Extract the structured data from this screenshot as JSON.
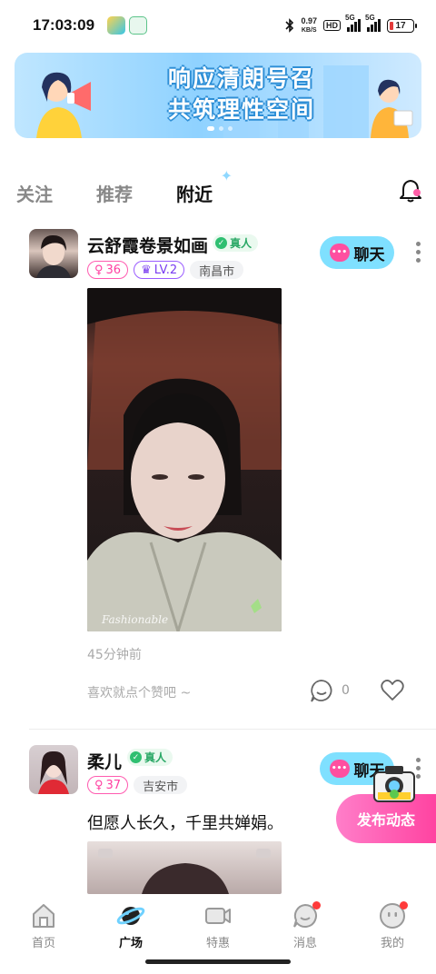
{
  "status_bar": {
    "time": "17:03:09",
    "net_speed_value": "0.97",
    "net_speed_unit": "KB/S",
    "hd_label": "HD",
    "sim1_label": "5G",
    "sim2_label": "5G",
    "battery_level": "17"
  },
  "banner": {
    "line1": "响应清朗号召",
    "line2": "共筑理性空间",
    "accent_color": "#2f8fd6"
  },
  "tabs": [
    {
      "label": "关注"
    },
    {
      "label": "推荐"
    },
    {
      "label": "附近"
    }
  ],
  "active_tab": "附近",
  "posts": [
    {
      "username": "云舒霞卷景如画",
      "verified_label": "真人",
      "likes_tag": "36",
      "level_tag": "LV.2",
      "city": "南昌市",
      "chat_label": "聊天",
      "photo_watermark": "Fashionable",
      "time_ago": "45分钟前",
      "like_hint": "喜欢就点个赞吧 ~",
      "comment_count": "0"
    },
    {
      "username": "柔儿",
      "verified_label": "真人",
      "likes_tag": "37",
      "city": "吉安市",
      "chat_label": "聊天",
      "text": "但愿人长久，千里共婵娟。"
    }
  ],
  "publish_label": "发布动态",
  "bottom_nav": [
    {
      "label": "首页",
      "icon": "home-icon"
    },
    {
      "label": "广场",
      "icon": "planet-icon"
    },
    {
      "label": "特惠",
      "icon": "video-icon"
    },
    {
      "label": "消息",
      "icon": "message-icon"
    },
    {
      "label": "我的",
      "icon": "profile-icon"
    }
  ],
  "active_nav": "广场"
}
